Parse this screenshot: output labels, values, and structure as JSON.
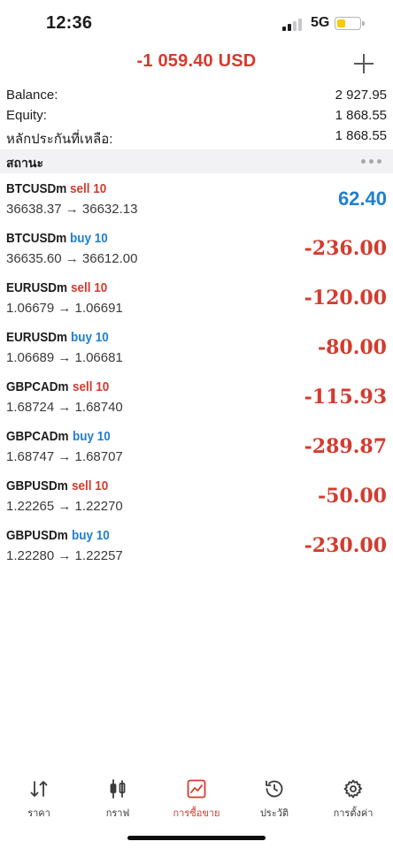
{
  "status_bar": {
    "time": "12:36",
    "network": "5G",
    "battery_color": "#f5cc00"
  },
  "header": {
    "total": "-1 059.40 USD",
    "add_icon": "plus-icon"
  },
  "summary": [
    {
      "label": "Balance:",
      "value": "2 927.95"
    },
    {
      "label": "Equity:",
      "value": "1 868.55"
    },
    {
      "label": "หลักประกันที่เหลือ:",
      "value": "1 868.55"
    }
  ],
  "section": {
    "title": "สถานะ",
    "more_icon": "more-dots-icon"
  },
  "colors": {
    "sell": "#d43b2e",
    "buy": "#1f7fd0",
    "loss": "#d43b2e",
    "profit": "#1f7fd0",
    "accent": "#d43b2e"
  },
  "positions": [
    {
      "symbol": "BTCUSDm",
      "side": "sell 10",
      "prices": "36638.37 → 36632.13",
      "profit": "62.40"
    },
    {
      "symbol": "BTCUSDm",
      "side": "buy 10",
      "prices": "36635.60 → 36612.00",
      "profit": "-236.00"
    },
    {
      "symbol": "EURUSDm",
      "side": "sell 10",
      "prices": "1.06679 → 1.06691",
      "profit": "-120.00"
    },
    {
      "symbol": "EURUSDm",
      "side": "buy 10",
      "prices": "1.06689 → 1.06681",
      "profit": "-80.00"
    },
    {
      "symbol": "GBPCADm",
      "side": "sell 10",
      "prices": "1.68724 → 1.68740",
      "profit": "-115.93"
    },
    {
      "symbol": "GBPCADm",
      "side": "buy 10",
      "prices": "1.68747 → 1.68707",
      "profit": "-289.87"
    },
    {
      "symbol": "GBPUSDm",
      "side": "sell 10",
      "prices": "1.22265 → 1.22270",
      "profit": "-50.00"
    },
    {
      "symbol": "GBPUSDm",
      "side": "buy 10",
      "prices": "1.22280 → 1.22257",
      "profit": "-230.00"
    }
  ],
  "nav": [
    {
      "label": "ราคา",
      "icon": "quotes-arrows-icon",
      "active": false
    },
    {
      "label": "กราฟ",
      "icon": "candlestick-chart-icon",
      "active": false
    },
    {
      "label": "การซื้อขาย",
      "icon": "trade-chart-icon",
      "active": true
    },
    {
      "label": "ประวัติ",
      "icon": "history-clock-icon",
      "active": false
    },
    {
      "label": "การตั้งค่า",
      "icon": "settings-gear-icon",
      "active": false
    }
  ]
}
